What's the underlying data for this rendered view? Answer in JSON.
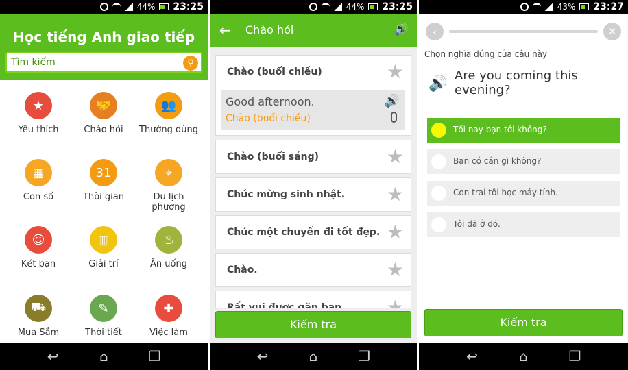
{
  "status_bars": [
    {
      "battery": "44%",
      "time": "23:25"
    },
    {
      "battery": "44%",
      "time": "23:25"
    },
    {
      "battery": "43%",
      "time": "23:27"
    }
  ],
  "home": {
    "title": "Học tiếng Anh giao tiếp",
    "search_placeholder": "Tìm kiếm",
    "categories": [
      {
        "label": "Yêu thích",
        "icon": "star-icon",
        "color": "#e74c3c"
      },
      {
        "label": "Chào hỏi",
        "icon": "handshake-icon",
        "color": "#e67e22"
      },
      {
        "label": "Thường dùng",
        "icon": "people-icon",
        "color": "#f39c12"
      },
      {
        "label": "Con số",
        "icon": "blocks-icon",
        "color": "#f5a623"
      },
      {
        "label": "Thời gian",
        "icon": "calendar-icon",
        "color": "#f39c12"
      },
      {
        "label": "Du lịch phương",
        "icon": "map-icon",
        "color": "#f5a623"
      },
      {
        "label": "Kết bạn",
        "icon": "friends-icon",
        "color": "#e74c3c"
      },
      {
        "label": "Giải trí",
        "icon": "building-icon",
        "color": "#f1c40f"
      },
      {
        "label": "Ăn uống",
        "icon": "dining-icon",
        "color": "#a0b33a"
      },
      {
        "label": "Mua Sắm",
        "icon": "shopping-icon",
        "color": "#8a7d2a"
      },
      {
        "label": "Thời tiết",
        "icon": "palette-icon",
        "color": "#6aa84f"
      },
      {
        "label": "Việc làm",
        "icon": "ambulance-icon",
        "color": "#e74c3c"
      }
    ]
  },
  "phrases": {
    "title": "Chào hỏi",
    "expanded": {
      "title": "Chào (buổi chiều)",
      "english": "Good afternoon.",
      "vietnamese": "Chào (buổi chiều)"
    },
    "items": [
      "Chào (buổi sáng)",
      "Chúc mừng sinh nhật.",
      "Chúc một chuyến đi tốt đẹp.",
      "Chào.",
      "Rất vui được gặp bạn."
    ],
    "check_label": "Kiểm tra"
  },
  "quiz": {
    "instruction": "Chọn nghĩa đúng của câu này",
    "question": "Are you coming this evening?",
    "options": [
      {
        "label": "Tối nay bạn tới không?",
        "selected": true
      },
      {
        "label": "Bạn có cần gì không?",
        "selected": false
      },
      {
        "label": "Con trai tôi học máy tính.",
        "selected": false
      },
      {
        "label": "Tôi đã ở đó.",
        "selected": false
      }
    ],
    "check_label": "Kiểm tra"
  },
  "colors": {
    "primary_green": "#5cbd1f",
    "accent_orange": "#f39c12",
    "selected_dot": "#f8f800"
  }
}
